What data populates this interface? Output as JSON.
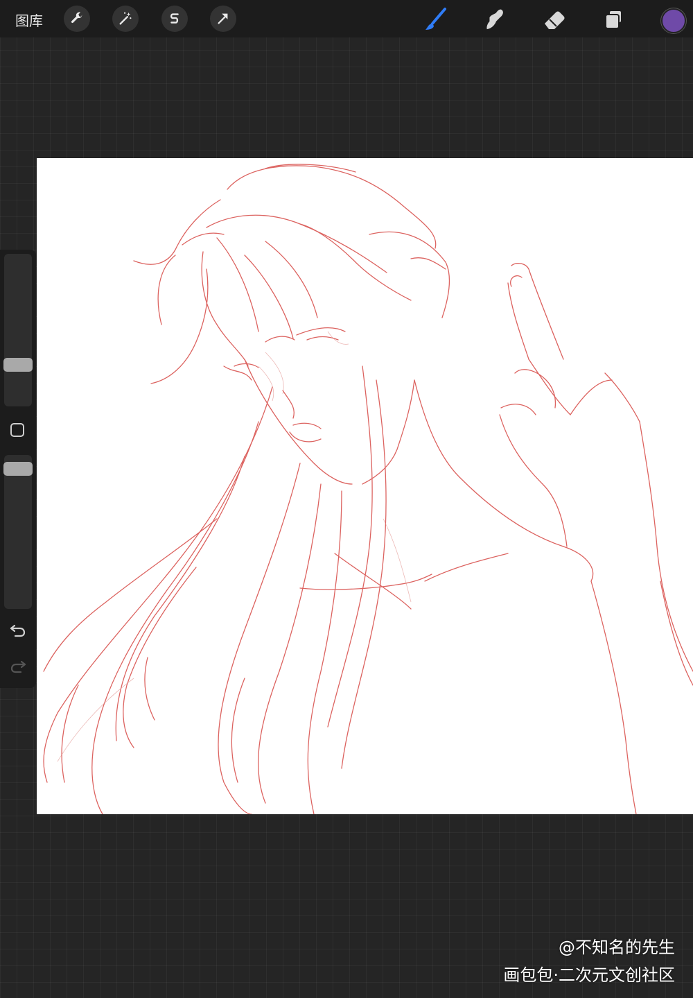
{
  "app": {
    "gallery_label": "图库",
    "colors": {
      "accent_brush": "#2f7cf6",
      "current_color": "#6f4aa8",
      "sketch_stroke": "#d9534f"
    }
  },
  "toolbar_left": [
    {
      "name": "actions",
      "icon": "wrench-icon"
    },
    {
      "name": "adjustments",
      "icon": "magic-wand-icon"
    },
    {
      "name": "selection",
      "icon": "selection-s-icon"
    },
    {
      "name": "transform",
      "icon": "arrow-cursor-icon"
    }
  ],
  "toolbar_right": [
    {
      "name": "brush",
      "icon": "brush-icon",
      "active": true
    },
    {
      "name": "smudge",
      "icon": "smudge-finger-icon",
      "active": false
    },
    {
      "name": "eraser",
      "icon": "eraser-icon",
      "active": false
    },
    {
      "name": "layers",
      "icon": "layers-icon",
      "active": false
    }
  ],
  "sidebar": {
    "brush_size_level": 0.25,
    "opacity_level": 0.95,
    "undo_icon": "undo-icon",
    "redo_icon": "redo-icon"
  },
  "watermark": {
    "line1": "@不知名的先生",
    "line2": "画包包·二次元文创社区"
  }
}
